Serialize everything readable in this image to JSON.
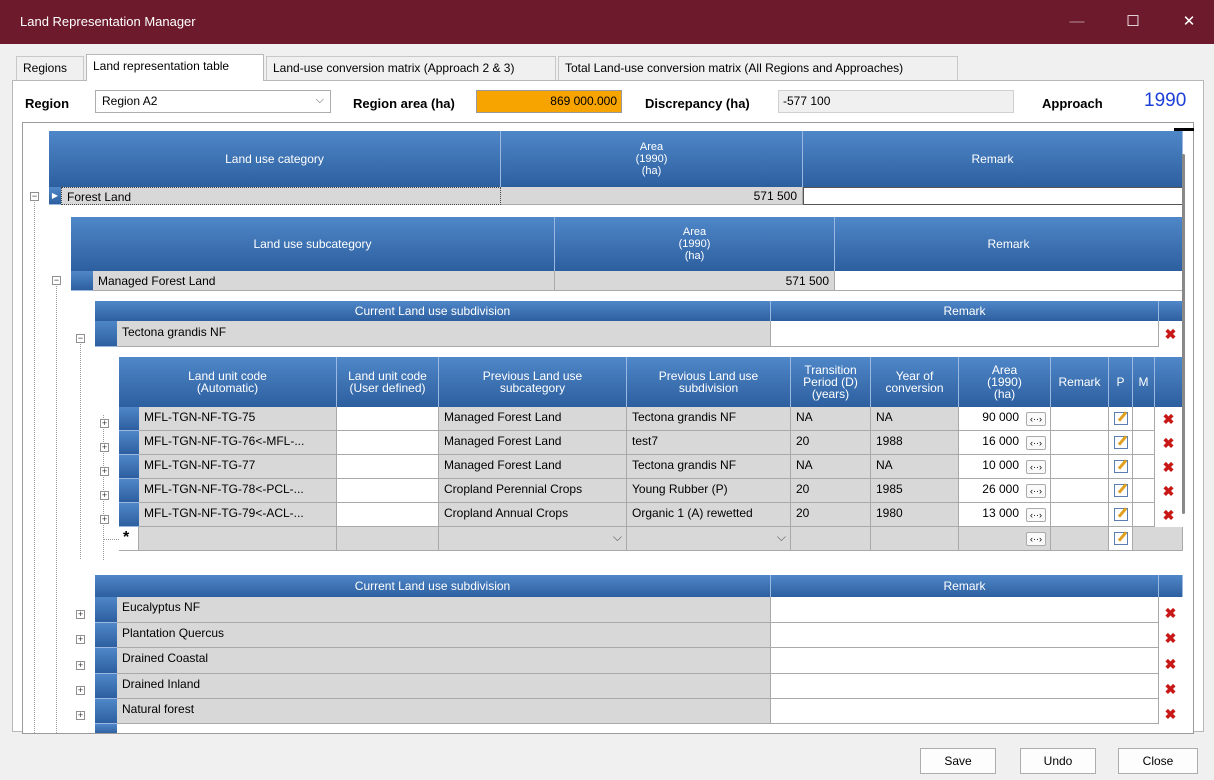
{
  "window": {
    "title": "Land Representation Manager",
    "minimize": "—",
    "maximize": "☐",
    "close": "✕"
  },
  "tabs": [
    "Regions",
    "Land representation table",
    "Land-use conversion matrix (Approach 2 & 3)",
    "Total Land-use conversion matrix (All Regions and Approaches)"
  ],
  "header": {
    "region_label": "Region",
    "region_value": "Region A2",
    "area_label": "Region area (ha)",
    "area_value": "869 000.000",
    "discrepancy_label": "Discrepancy (ha)",
    "discrepancy_value": "-577 100",
    "approach_label": "Approach",
    "year": "1990",
    "area_color": "#f7a300",
    "year_color": "#1c3fd6"
  },
  "level1": {
    "col_category": "Land use category",
    "col_area": "Area\n(1990)\n(ha)",
    "col_remark": "Remark",
    "row": {
      "category": "Forest Land",
      "area": "571 500",
      "remark": ""
    }
  },
  "level2": {
    "col_subcategory": "Land use subcategory",
    "col_area": "Area\n(1990)\n(ha)",
    "col_remark": "Remark",
    "row": {
      "subcategory": "Managed Forest Land",
      "area": "571 500",
      "remark": ""
    }
  },
  "level3": {
    "col_subdivision": "Current Land use subdivision",
    "col_remark": "Remark",
    "row": {
      "subdivision": "Tectona grandis NF",
      "remark": ""
    }
  },
  "units": {
    "columns": [
      "Land unit code\n(Automatic)",
      "Land unit code\n(User defined)",
      "Previous Land use\nsubcategory",
      "Previous Land use\nsubdivision",
      "Transition\nPeriod (D)\n(years)",
      "Year of\nconversion",
      "Area\n(1990)\n(ha)",
      "Remark",
      "P",
      "M"
    ],
    "rows": [
      {
        "code": "MFL-TGN-NF-TG-75",
        "user": "",
        "prev_cat": "Managed Forest Land",
        "prev_sub": "Tectona grandis NF",
        "period": "NA",
        "year": "NA",
        "area": "90 000"
      },
      {
        "code": "MFL-TGN-NF-TG-76<-MFL-...",
        "user": "",
        "prev_cat": "Managed Forest Land",
        "prev_sub": "test7",
        "period": "20",
        "year": "1988",
        "area": "16 000"
      },
      {
        "code": "MFL-TGN-NF-TG-77",
        "user": "",
        "prev_cat": "Managed Forest Land",
        "prev_sub": "Tectona grandis NF",
        "period": "NA",
        "year": "NA",
        "area": "10 000"
      },
      {
        "code": "MFL-TGN-NF-TG-78<-PCL-...",
        "user": "",
        "prev_cat": "Cropland Perennial Crops",
        "prev_sub": "Young Rubber (P)",
        "period": "20",
        "year": "1985",
        "area": "26 000"
      },
      {
        "code": "MFL-TGN-NF-TG-79<-ACL-...",
        "user": "",
        "prev_cat": "Cropland Annual Crops",
        "prev_sub": "Organic 1 (A) rewetted",
        "period": "20",
        "year": "1980",
        "area": "13 000"
      }
    ],
    "new_row_marker": "*",
    "arrow_glyph": "‹··›"
  },
  "level3b": {
    "col_subdivision": "Current Land use subdivision",
    "col_remark": "Remark",
    "rows": [
      "Eucalyptus NF",
      "Plantation Quercus",
      "Drained Coastal",
      "Drained Inland",
      "Natural forest"
    ]
  },
  "buttons": {
    "save": "Save",
    "undo": "Undo",
    "close": "Close"
  }
}
